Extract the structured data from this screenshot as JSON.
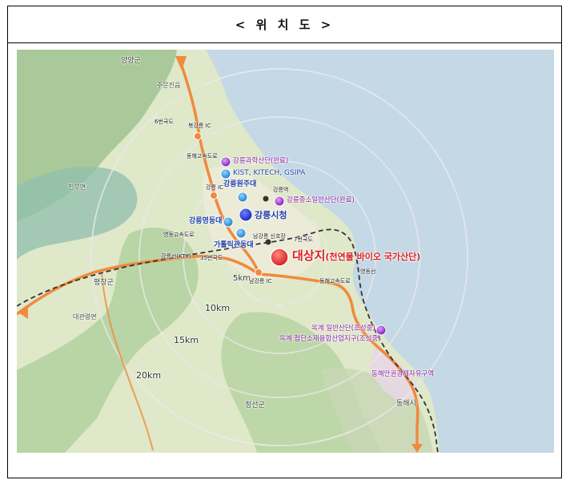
{
  "title": "< 위 치 도 >",
  "map": {
    "target": {
      "name": "대상지",
      "sub": "(천연물 바이오 국가산단)"
    },
    "city_hall": "강릉시청",
    "complexes": {
      "science": "강릉과학산단(완료)",
      "institutes": "KIST, KITECH, GSIPA",
      "sme": "강릉중소일반산단(완료)",
      "okgye1": "옥계 일반산단(조성중)",
      "okgye2": "옥계 첨단소재융합산업지구(조성중)",
      "fez": "동해안권경제자유구역"
    },
    "universities": {
      "wonju": "강릉원주대",
      "yeongdong": "강릉영동대",
      "catholic": "가톨릭관동대"
    },
    "rings": [
      "5km",
      "10km",
      "15km",
      "20km"
    ],
    "places": {
      "yangyang": "양양군",
      "jumun": "주문진읍",
      "pyeongchang": "평창군",
      "jeongseon": "정선군",
      "donghae": "동해시",
      "jinbu": "진부면",
      "daegwallyeong": "대관령면",
      "yeongok": "연곡면",
      "sacheon": "사천면",
      "donghae_city": "동해시"
    },
    "roads": {
      "r6": "6번국도",
      "bukgangneung": "북강릉 IC",
      "donghae_exp": "동해고속도로",
      "gangneung_ic": "강릉 IC",
      "yeongdong_exp": "영동고속도로",
      "ktx": "강릉선(KTX)",
      "r35": "35번국도",
      "r7": "7번국도",
      "donghae_exp2": "동해고속도로",
      "namgangneung": "남강릉 IC",
      "gangneung_station": "강릉역",
      "namgangneung_station": "남강릉 신호장",
      "yeongdong_line": "영동선"
    },
    "colors": {
      "sea": "#c4d8e6",
      "land": "#dfe8c9",
      "forest": "#a8c99a",
      "urban": "#ecebd9",
      "highway": "#f08a3c",
      "railway": "#333333",
      "target": "#e8231f",
      "city_hall": "#1f2ecf",
      "university": "#2e8fd6",
      "complex": "#9a2fc4"
    }
  }
}
